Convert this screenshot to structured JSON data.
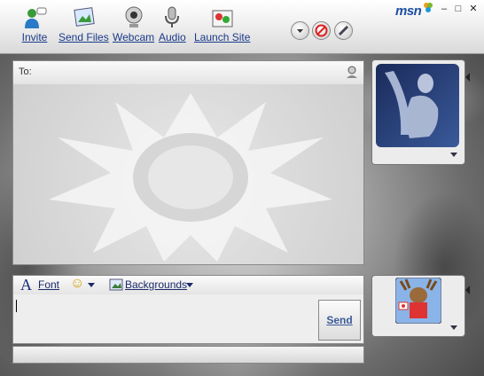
{
  "toolbar": {
    "invite_label": "Invite",
    "send_files_label": "Send Files",
    "webcam_label": "Webcam",
    "audio_label": "Audio",
    "launch_site_label": "Launch Site"
  },
  "brand": {
    "logo_text": "msn"
  },
  "window_controls": {
    "minimize": "–",
    "maximize": "□",
    "close": "✕"
  },
  "to_bar": {
    "label": "To:"
  },
  "format_bar": {
    "font_glyph": "A",
    "font_label": "Font",
    "emoticon_glyph": "☺",
    "backgrounds_label": "Backgrounds"
  },
  "compose": {
    "send_label": "Send"
  },
  "icons": [
    "invite-icon",
    "send-files-icon",
    "webcam-icon",
    "audio-icon",
    "launch-site-icon",
    "contact-card-icon",
    "block-icon",
    "paint-icon",
    "font-icon",
    "emoticon-icon",
    "backgrounds-icon",
    "dropdown-arrow-icon"
  ],
  "colors": {
    "link_blue": "#1a3a8a",
    "msn_blue": "#1d4fa3",
    "send_text": "#3a5a98"
  }
}
